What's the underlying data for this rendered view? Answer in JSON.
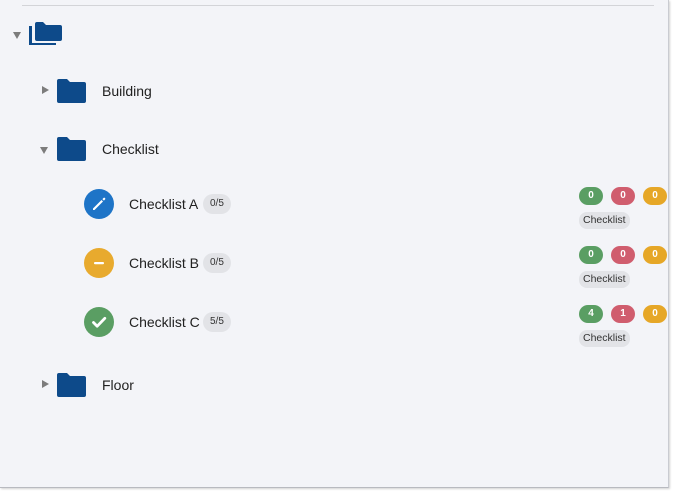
{
  "colors": {
    "folder": "#0d4a8a",
    "in_progress": "#1e74c7",
    "not_started": "#e8aa2e",
    "done": "#5a9e63",
    "badge_green": "#5a9e63",
    "badge_red": "#d05d6e",
    "badge_yellow": "#e6a727"
  },
  "tree": {
    "root": {
      "icon": "folders-icon",
      "expanded": true
    },
    "folders": [
      {
        "label": "Building",
        "expanded": false
      },
      {
        "label": "Checklist",
        "expanded": true
      },
      {
        "label": "Floor",
        "expanded": false
      }
    ],
    "items": [
      {
        "label": "Checklist A",
        "progress": "0/5",
        "status_icon": "pencil-icon",
        "counts": [
          "0",
          "0",
          "0"
        ],
        "type": "Checklist"
      },
      {
        "label": "Checklist B",
        "progress": "0/5",
        "status_icon": "minus-icon",
        "counts": [
          "0",
          "0",
          "0"
        ],
        "type": "Checklist"
      },
      {
        "label": "Checklist C",
        "progress": "5/5",
        "status_icon": "check-icon",
        "counts": [
          "4",
          "1",
          "0"
        ],
        "type": "Checklist"
      }
    ]
  }
}
